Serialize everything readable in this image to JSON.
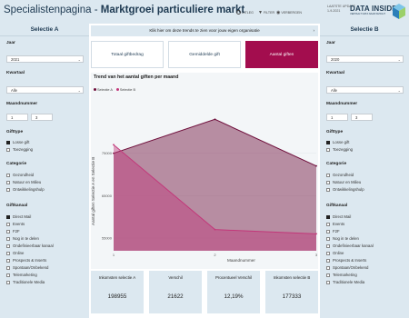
{
  "header": {
    "title_light": "Specialistenpagina - ",
    "title_bold": "Marktgroei particuliere markt",
    "uitleg": "UITLEG",
    "filter": "FILTER",
    "verbergen": "VERBERGEN",
    "date_label": "LAATSTE UPDATE",
    "date": "1-9-2021",
    "logo": "DATA INSIDE",
    "logo_sub": "VERTAALT DATA NAAR INZICHT"
  },
  "left": {
    "heading": "Selectie A",
    "year_label": "Jaar",
    "year": "2021",
    "quarter_label": "Kwartaal",
    "quarter": "Alle",
    "month_label": "Maandnummer",
    "month_from": "1",
    "month_to": "3",
    "gifttype_label": "Gifttype",
    "gifttypes": [
      {
        "label": "Losse gift",
        "checked": true
      },
      {
        "label": "Toezegging",
        "checked": false
      }
    ],
    "categorie_label": "Categorie",
    "categories": [
      {
        "label": "Gezondheid",
        "checked": false
      },
      {
        "label": "Natuur en Milieu",
        "checked": false
      },
      {
        "label": "Ontwikkelingshulp",
        "checked": false
      }
    ],
    "kanaal_label": "Giftkanaal",
    "kanalen": [
      {
        "label": "Direct Mail",
        "checked": true
      },
      {
        "label": "Events",
        "checked": false
      },
      {
        "label": "F2F",
        "checked": false
      },
      {
        "label": "Nog in te delen",
        "checked": false
      },
      {
        "label": "Ondefinieerbaar kanaal",
        "checked": false
      },
      {
        "label": "Online",
        "checked": false
      },
      {
        "label": "Prospects & Inserts",
        "checked": false
      },
      {
        "label": "Spontaan/Onbekend",
        "checked": false
      },
      {
        "label": "Telemarketing",
        "checked": false
      },
      {
        "label": "Traditionele Media",
        "checked": false
      }
    ]
  },
  "right": {
    "heading": "Selectie B",
    "year_label": "Jaar",
    "year": "2020",
    "quarter_label": "Kwartaal",
    "quarter": "Alle",
    "month_label": "Maandnummer",
    "month_from": "1",
    "month_to": "3",
    "gifttype_label": "Gifttype",
    "gifttypes": [
      {
        "label": "Losse gift",
        "checked": true
      },
      {
        "label": "Toezegging",
        "checked": false
      }
    ],
    "categorie_label": "Categorie",
    "categories": [
      {
        "label": "Gezondheid",
        "checked": false
      },
      {
        "label": "Natuur en Milieu",
        "checked": false
      },
      {
        "label": "Ontwikkelingshulp",
        "checked": false
      }
    ],
    "kanaal_label": "Giftkanaal",
    "kanalen": [
      {
        "label": "Direct Mail",
        "checked": true
      },
      {
        "label": "Events",
        "checked": false
      },
      {
        "label": "F2F",
        "checked": false
      },
      {
        "label": "Nog in te delen",
        "checked": false
      },
      {
        "label": "Ondefinieerbaar kanaal",
        "checked": false
      },
      {
        "label": "Online",
        "checked": false
      },
      {
        "label": "Prospects & Inserts",
        "checked": false
      },
      {
        "label": "Spontaan/Onbekend",
        "checked": false
      },
      {
        "label": "Telemarketing",
        "checked": false
      },
      {
        "label": "Traditionele Media",
        "checked": false
      }
    ]
  },
  "banner": "Klik hier om deze trends te zien voor jouw eigen organisatie",
  "tabs": [
    "Totaal giftbedrag",
    "Gemiddelde gift",
    "Aantal giften"
  ],
  "active_tab": 2,
  "chart_data": {
    "type": "area",
    "title": "Trend van het aantal giften per maand",
    "xlabel": "Maandnummer",
    "ylabel": "Aantal giften Selectie A en Selectie B",
    "x": [
      1,
      2,
      3
    ],
    "ylim": [
      52000,
      88000
    ],
    "yticks": [
      55000,
      65000,
      75000
    ],
    "series": [
      {
        "name": "Selectie A",
        "values": [
          75000,
          83000,
          72000
        ],
        "color": "#6e0d3a"
      },
      {
        "name": "Selectie B",
        "values": [
          77000,
          57000,
          56000
        ],
        "color": "#c2387a"
      }
    ]
  },
  "kpis": [
    {
      "label": "Inkomsten selectie A",
      "value": "198955"
    },
    {
      "label": "Verschil",
      "value": "21622"
    },
    {
      "label": "Procentueel Verschil",
      "value": "12,19%"
    },
    {
      "label": "Inkomsten selectie B",
      "value": "177333"
    }
  ],
  "colors": {
    "panel": "#dce8f0",
    "accent": "#a30d4e",
    "navy": "#1e3a52"
  }
}
